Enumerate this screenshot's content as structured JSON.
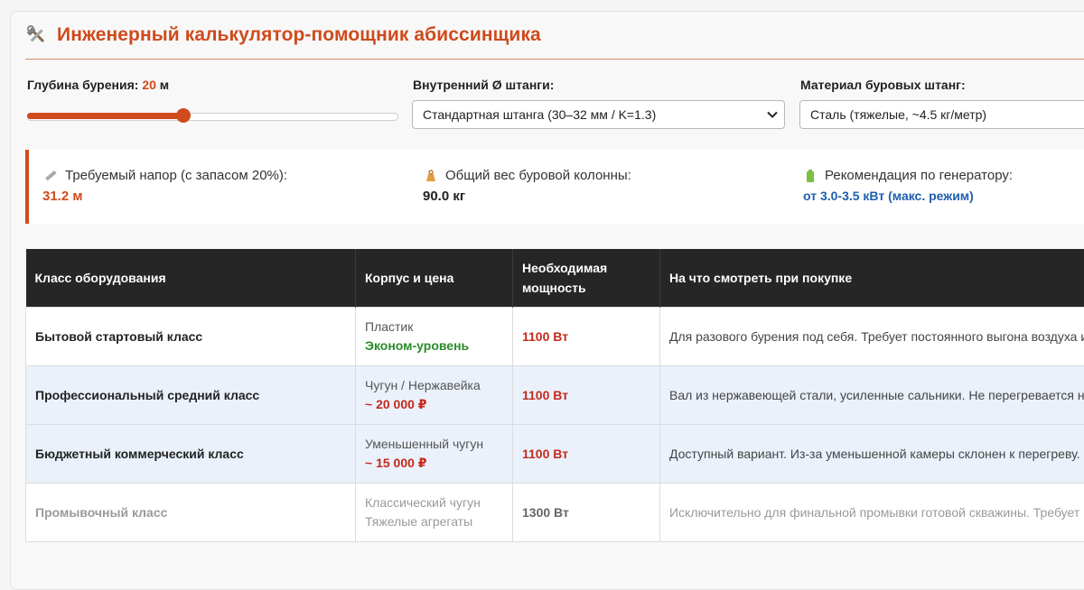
{
  "header": {
    "title": "Инженерный калькулятор-помощник абиссинщика",
    "icon": "hammer-wrench-icon"
  },
  "controls": {
    "depth": {
      "label": "Глубина бурения:",
      "value": "20",
      "unit": "м",
      "slider_fraction": 0.42
    },
    "rod_diameter": {
      "label": "Внутренний Ø штанги:",
      "selected": "Стандартная штанга (30–32 мм / K=1.3)"
    },
    "rod_material": {
      "label": "Материал буровых штанг:",
      "selected": "Сталь (тяжелые, ~4.5 кг/метр)"
    }
  },
  "stats": {
    "head": {
      "icon": "ruler-icon",
      "label": "Требуемый напор (с запасом 20%):",
      "value": "31.2 м"
    },
    "weight": {
      "icon": "weight-icon",
      "label": "Общий вес буровой колонны:",
      "value": "90.0 кг"
    },
    "generator": {
      "icon": "battery-icon",
      "label": "Рекомендация по генератору:",
      "value": "от 3.0-3.5 кВт (макс. режим)"
    }
  },
  "table": {
    "headers": [
      "Класс оборудования",
      "Корпус и цена",
      "Необходимая мощность",
      "На что смотреть при покупке"
    ],
    "header_power_line1": "Необходимая",
    "header_power_line2": "мощность",
    "rows": [
      {
        "class": "Бытовой стартовый класс",
        "body": "Пластик",
        "price": "Эконом-уровень",
        "power": "1100 Вт",
        "note": "Для разового бурения под себя. Требует постоянного выгона воздуха и"
      },
      {
        "class": "Профессиональный средний класс",
        "body": "Чугун / Нержавейка",
        "price": "~ 20 000 ₽",
        "power": "1100 Вт",
        "note": "Вал из нержавеющей стали, усиленные сальники. Не перегревается н"
      },
      {
        "class": "Бюджетный коммерческий класс",
        "body": "Уменьшенный чугун",
        "price": "~ 15 000 ₽",
        "power": "1100 Вт",
        "note": "Доступный вариант. Из-за уменьшенной камеры склонен к перегреву."
      },
      {
        "class": "Промывочный класс",
        "body": "Классический чугун",
        "price": "Тяжелые агрегаты",
        "power": "1300 Вт",
        "note": "Исключительно для финальной промывки готовой скважины. Требует"
      }
    ]
  },
  "colors": {
    "accent": "#cf4a1c",
    "table_header": "#262626",
    "row_highlight": "#eaf1fb",
    "link_blue": "#1f5fb0",
    "price_green": "#2a8a2a"
  }
}
